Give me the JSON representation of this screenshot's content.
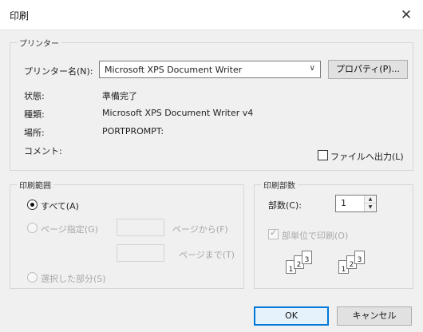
{
  "dialog": {
    "title": "印刷"
  },
  "printer": {
    "group_label": "プリンター",
    "name_label": "プリンター名(N):",
    "name_value": "Microsoft XPS Document Writer",
    "properties_button": "プロパティ(P)...",
    "status_label": "状態:",
    "status_value": "準備完了",
    "type_label": "種類:",
    "type_value": "Microsoft XPS Document Writer v4",
    "location_label": "場所:",
    "location_value": "PORTPROMPT:",
    "comment_label": "コメント:",
    "print_to_file_label": "ファイルへ出力(L)"
  },
  "range": {
    "group_label": "印刷範囲",
    "all_label": "すべて(A)",
    "pages_label": "ページ指定(G)",
    "from_label": "ページから(F)",
    "to_label": "ページまで(T)",
    "selection_label": "選択した部分(S)"
  },
  "copies": {
    "group_label": "印刷部数",
    "count_label": "部数(C):",
    "count_value": "1",
    "collate_label": "部単位で印刷(O)"
  },
  "buttons": {
    "ok": "OK",
    "cancel": "キャンセル"
  },
  "icons": {
    "close": "close-icon",
    "dropdown": "chevron-down-icon",
    "collate": "collate-pages-icon"
  }
}
